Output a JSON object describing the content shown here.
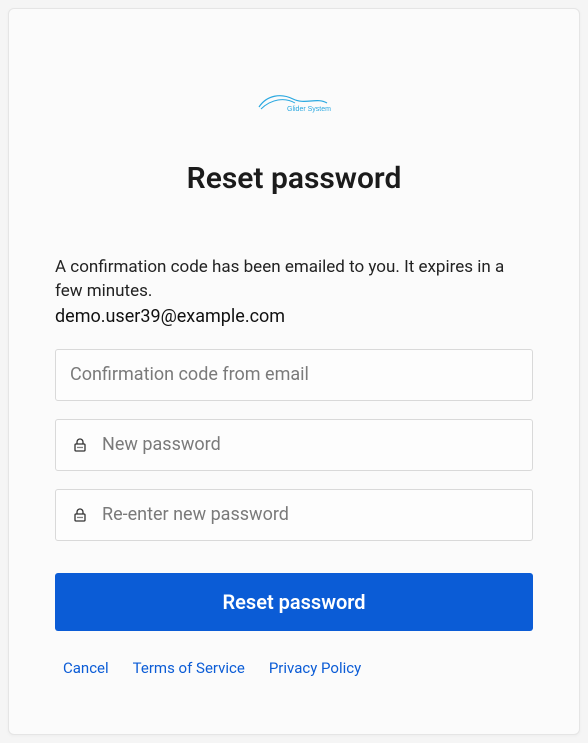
{
  "brand": {
    "name": "Glider Systems",
    "accent_color": "#0b5cd6"
  },
  "title": "Reset password",
  "instruction": "A confirmation code has been emailed to you. It expires in a few minutes.",
  "email": "demo.user39@example.com",
  "fields": {
    "code": {
      "placeholder": "Confirmation code from email",
      "value": ""
    },
    "new_password": {
      "placeholder": "New password",
      "value": ""
    },
    "reenter_password": {
      "placeholder": "Re-enter new password",
      "value": ""
    }
  },
  "buttons": {
    "submit": "Reset password"
  },
  "links": {
    "cancel": "Cancel",
    "tos": "Terms of Service",
    "privacy": "Privacy Policy"
  }
}
